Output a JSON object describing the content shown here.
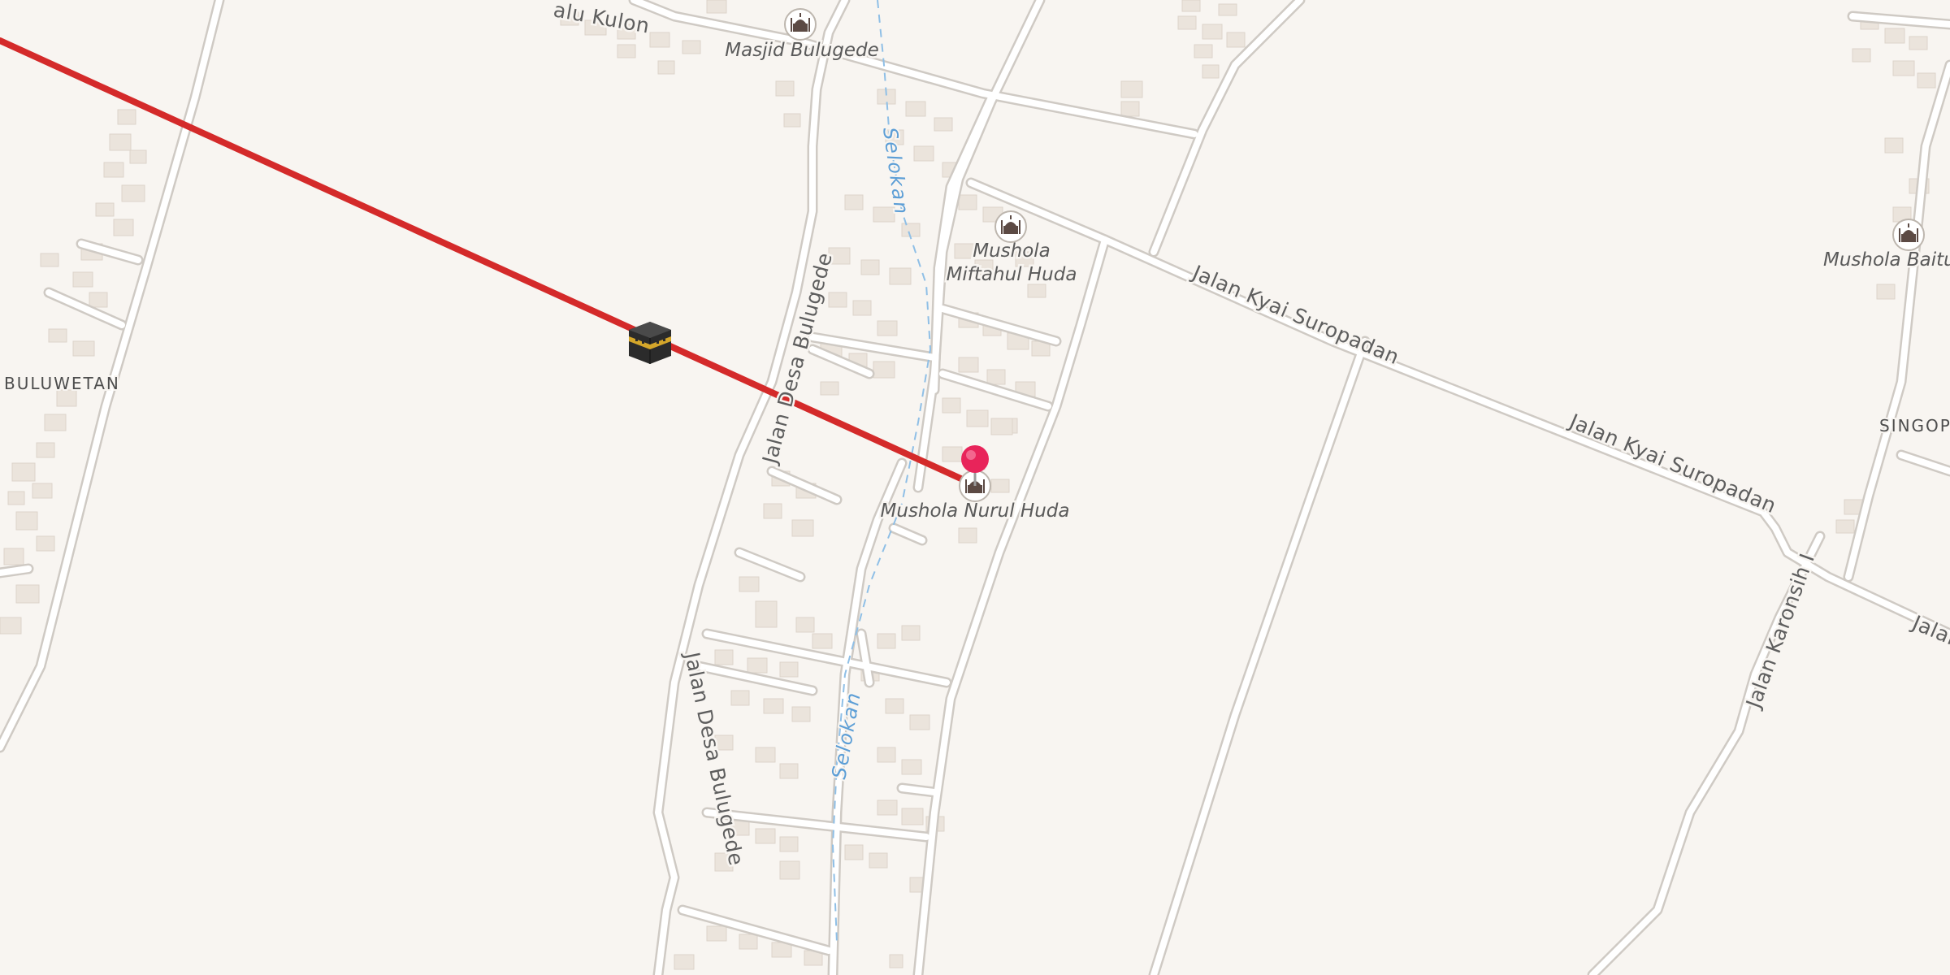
{
  "map": {
    "roads": [
      {
        "id": "jalan-kyai-suropadan",
        "labels": [
          "Jalan Kyai Suropadan",
          "Jalan Kyai Suropadan"
        ]
      },
      {
        "id": "jalan-desa-bulugede",
        "labels": [
          "Jalan Desa Bulugede",
          "Jalan Desa Bulugede"
        ]
      },
      {
        "id": "jalan-karonsih-i",
        "labels": [
          "Jalan Karonsih I"
        ]
      },
      {
        "id": "partial-kulon",
        "labels": [
          "alu Kulon"
        ]
      },
      {
        "id": "partial-jalan-east",
        "labels": [
          "Jalan"
        ]
      }
    ],
    "waterways": [
      {
        "id": "selokan",
        "labels": [
          "Selokan",
          "Selokan"
        ]
      }
    ],
    "places": [
      {
        "id": "buluwetan",
        "label": "BULUWETAN"
      },
      {
        "id": "singopadu",
        "label": "SINGOPA"
      }
    ],
    "pois": [
      {
        "id": "masjid-bulugede",
        "label": "Masjid Bulugede",
        "icon": "mosque-icon"
      },
      {
        "id": "mushola-miftahul-huda",
        "label_line1": "Mushola",
        "label_line2": "Miftahul Huda",
        "icon": "mosque-icon"
      },
      {
        "id": "mushola-nurul-huda",
        "label": "Mushola Nurul Huda",
        "icon": "mosque-icon"
      },
      {
        "id": "mushola-baitul",
        "label": "Mushola Baitul",
        "icon": "mosque-icon"
      }
    ],
    "markers": {
      "location_pin": {
        "icon": "location-pin-icon",
        "color": "#e8245a"
      },
      "kaaba": {
        "icon": "kaaba-icon"
      }
    },
    "qibla_line": {
      "color": "#d42a2a"
    }
  }
}
